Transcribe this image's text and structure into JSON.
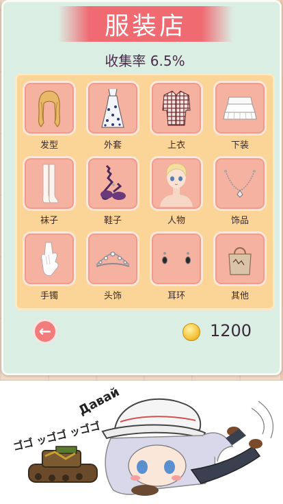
{
  "header": {
    "title": "服装店"
  },
  "collection": {
    "label": "收集率 6.5%"
  },
  "categories": [
    {
      "label": "发型",
      "icon": "hair-icon"
    },
    {
      "label": "外套",
      "icon": "dress-icon"
    },
    {
      "label": "上衣",
      "icon": "shirt-icon"
    },
    {
      "label": "下装",
      "icon": "skirt-icon"
    },
    {
      "label": "袜子",
      "icon": "stockings-icon"
    },
    {
      "label": "鞋子",
      "icon": "shoes-icon"
    },
    {
      "label": "人物",
      "icon": "character-icon"
    },
    {
      "label": "饰品",
      "icon": "necklace-icon"
    },
    {
      "label": "手镯",
      "icon": "glove-icon"
    },
    {
      "label": "头饰",
      "icon": "tiara-icon"
    },
    {
      "label": "耳环",
      "icon": "earrings-icon"
    },
    {
      "label": "其他",
      "icon": "bag-icon"
    }
  ],
  "footer": {
    "coins": "1200",
    "back_icon": "back-arrow-icon",
    "coin_icon": "coin-icon"
  },
  "bottom_image": {
    "text_top": "Давай",
    "text_left": "ゴゴ ッゴゴ ッゴゴ",
    "icon": "chibi-character-with-tank-illustration"
  },
  "colors": {
    "panel": "#dbeee4",
    "banner": "#f06a72",
    "grid": "#fbd597",
    "tile": "#f6b2a0",
    "back_button": "#f27b7b"
  }
}
